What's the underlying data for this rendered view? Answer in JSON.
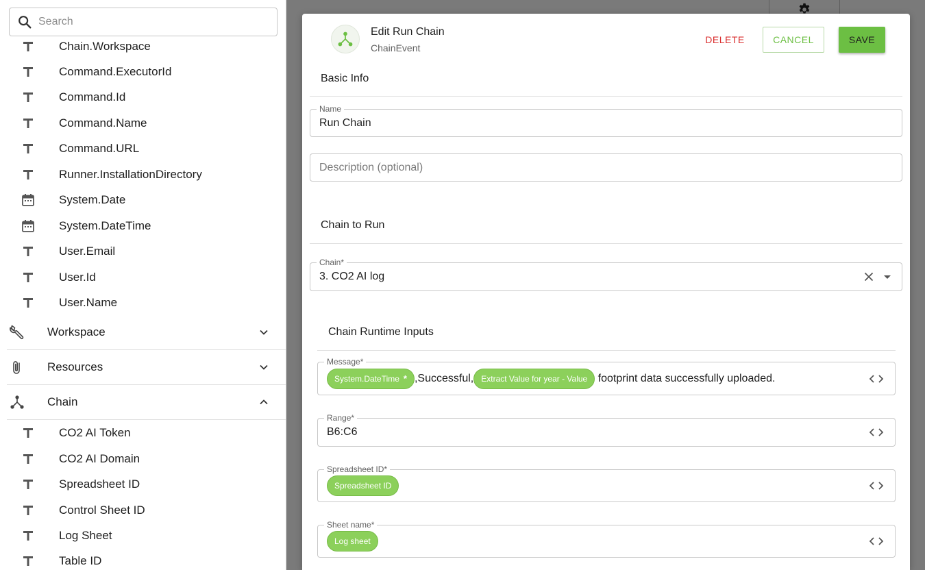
{
  "sidebar": {
    "search_placeholder": "Search",
    "variables_top": [
      {
        "label": "Chain.Workspace",
        "icon": "text-type-icon"
      },
      {
        "label": "Command.ExecutorId",
        "icon": "text-type-icon"
      },
      {
        "label": "Command.Id",
        "icon": "text-type-icon"
      },
      {
        "label": "Command.Name",
        "icon": "text-type-icon"
      },
      {
        "label": "Command.URL",
        "icon": "text-type-icon"
      },
      {
        "label": "Runner.InstallationDirectory",
        "icon": "text-type-icon"
      },
      {
        "label": "System.Date",
        "icon": "calendar-icon"
      },
      {
        "label": "System.DateTime",
        "icon": "calendar-icon"
      },
      {
        "label": "User.Email",
        "icon": "text-type-icon"
      },
      {
        "label": "User.Id",
        "icon": "text-type-icon"
      },
      {
        "label": "User.Name",
        "icon": "text-type-icon"
      }
    ],
    "sections": [
      {
        "label": "Workspace",
        "icon": "wrench-icon",
        "state": "collapsed"
      },
      {
        "label": "Resources",
        "icon": "paperclip-icon",
        "state": "collapsed"
      },
      {
        "label": "Chain",
        "icon": "chain-icon",
        "state": "expanded"
      }
    ],
    "chain_variables": [
      {
        "label": "CO2 AI Token",
        "icon": "text-type-icon"
      },
      {
        "label": "CO2 AI Domain",
        "icon": "text-type-icon"
      },
      {
        "label": "Spreadsheet ID",
        "icon": "text-type-icon"
      },
      {
        "label": "Control Sheet ID",
        "icon": "text-type-icon"
      },
      {
        "label": "Log Sheet",
        "icon": "text-type-icon"
      },
      {
        "label": "Table ID",
        "icon": "text-type-icon"
      }
    ]
  },
  "dialog": {
    "title": "Edit Run Chain",
    "subtitle": "ChainEvent",
    "delete_label": "DELETE",
    "cancel_label": "CANCEL",
    "save_label": "SAVE",
    "basic_info": {
      "heading": "Basic Info",
      "name_label": "Name",
      "name_value": "Run Chain",
      "description_placeholder": "Description (optional)"
    },
    "chain_to_run": {
      "heading": "Chain to Run",
      "chain_label": "Chain*",
      "chain_value": "3. CO2 AI log"
    },
    "runtime_inputs": {
      "heading": "Chain Runtime Inputs",
      "message": {
        "label": "Message*",
        "chip1": "System.DateTime",
        "chip1_remove": "*",
        "text1": ",Successful,",
        "chip2": "Extract Value for year - Value",
        "text2": " footprint data successfully uploaded."
      },
      "range": {
        "label": "Range*",
        "value": "B6:C6"
      },
      "spreadsheet_id": {
        "label": "Spreadsheet ID*",
        "chip": "Spreadsheet ID"
      },
      "sheet_name": {
        "label": "Sheet name*",
        "chip": "Log sheet"
      }
    }
  },
  "colors": {
    "accent_green": "#6cbf43",
    "chip_green": "#8cd05b",
    "delete_red": "#d92c2c",
    "overlay_gray": "#7a7a7a"
  }
}
